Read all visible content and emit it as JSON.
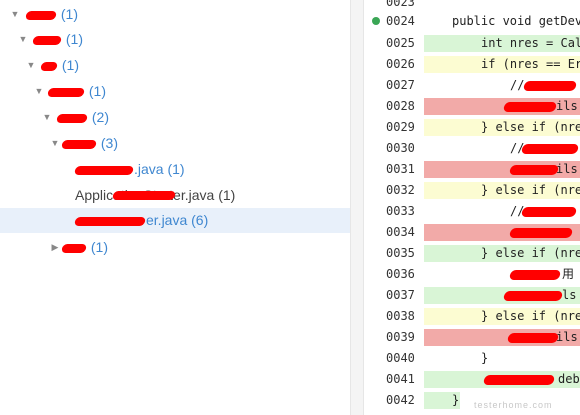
{
  "tree": {
    "rows": [
      {
        "label_visible": "(1)",
        "count": "(1)"
      },
      {
        "label_visible": "com",
        "count": "(1)"
      },
      {
        "label_visible": "",
        "count": "(1)"
      },
      {
        "label_visible": "",
        "count": "(1)"
      },
      {
        "label_visible": "",
        "count": "(2)"
      },
      {
        "label_visible": "",
        "count": "(3)"
      },
      {
        "label_visible": ".java",
        "count": "(1)"
      },
      {
        "label_visible": "ApplicationStarter.java",
        "count": "(1)"
      },
      {
        "label_visible": "er.java",
        "count": "(6)"
      },
      {
        "label_visible": "",
        "count": "(1)"
      }
    ]
  },
  "code": {
    "lines": [
      {
        "num": "0023",
        "text": ""
      },
      {
        "num": "0024",
        "text": "public void getDev"
      },
      {
        "num": "0025",
        "text": "int nres = Cal"
      },
      {
        "num": "0026",
        "text": "if (nres == Er"
      },
      {
        "num": "0027",
        "text": "//"
      },
      {
        "num": "0028",
        "text": "ils"
      },
      {
        "num": "0029",
        "text": "} else if (nre"
      },
      {
        "num": "0030",
        "text": "//"
      },
      {
        "num": "0031",
        "text": "ils"
      },
      {
        "num": "0032",
        "text": "} else if (nre"
      },
      {
        "num": "0033",
        "text": "//"
      },
      {
        "num": "0034",
        "text": ""
      },
      {
        "num": "0035",
        "text": "} else if (nre"
      },
      {
        "num": "0036",
        "text": "用"
      },
      {
        "num": "0037",
        "text": "ls"
      },
      {
        "num": "0038",
        "text": "} else if (nre"
      },
      {
        "num": "0039",
        "text": "ils"
      },
      {
        "num": "0040",
        "text": "}"
      },
      {
        "num": "0041",
        "text": "deb"
      },
      {
        "num": "0042",
        "text": "}"
      }
    ]
  },
  "watermark": "testerhome.com",
  "colors": {
    "tree_text": "#3f87d0",
    "selected_row": "#e8f0fa",
    "covered_line": "#d9f5d6",
    "partial_line": "#fcfcd2",
    "missed_line": "#f2aaa8",
    "redaction": "#ff0000"
  }
}
